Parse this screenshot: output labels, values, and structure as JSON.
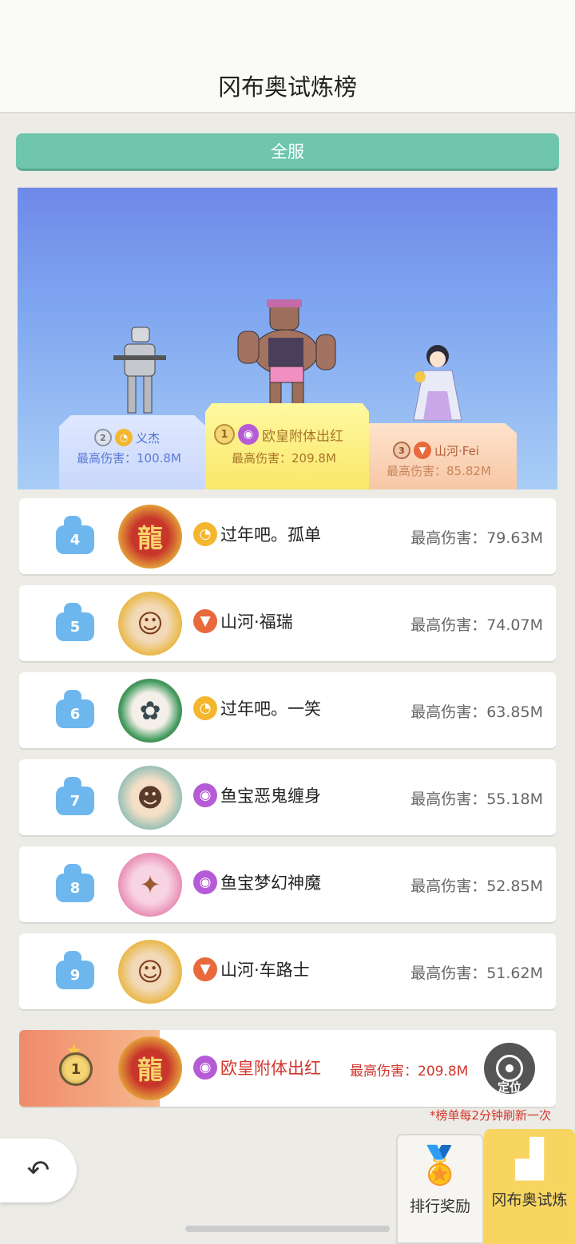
{
  "header": {
    "title": "冈布奥试炼榜"
  },
  "scope": {
    "label": "全服"
  },
  "podium": {
    "first": {
      "rank": "1",
      "server_icon": "eye-icon",
      "name": "欧皇附体出红",
      "damage": "最高伤害：209.8M"
    },
    "second": {
      "rank": "2",
      "server_icon": "gold-swirl-icon",
      "name": "义杰",
      "damage": "最高伤害：100.8M"
    },
    "third": {
      "rank": "3",
      "server_icon": "fox-icon",
      "name": "山河·Fei",
      "damage": "最高伤害：85.82M"
    }
  },
  "rows": [
    {
      "rank": "4",
      "server_icon": "gold-swirl-icon",
      "name": "过年吧。孤单",
      "damage": "最高伤害：79.63M"
    },
    {
      "rank": "5",
      "server_icon": "fox-icon",
      "name": "山河·福瑞",
      "damage": "最高伤害：74.07M"
    },
    {
      "rank": "6",
      "server_icon": "gold-swirl-icon",
      "name": "过年吧。一笑",
      "damage": "最高伤害：63.85M"
    },
    {
      "rank": "7",
      "server_icon": "eye-icon",
      "name": "鱼宝恶鬼缠身",
      "damage": "最高伤害：55.18M"
    },
    {
      "rank": "8",
      "server_icon": "eye-icon",
      "name": "鱼宝梦幻神魔",
      "damage": "最高伤害：52.85M"
    },
    {
      "rank": "9",
      "server_icon": "fox-icon",
      "name": "山河·车路士",
      "damage": "最高伤害：51.62M"
    }
  ],
  "my_rank": {
    "rank": "1",
    "server_icon": "eye-icon",
    "name": "欧皇附体出红",
    "damage": "最高伤害：209.8M",
    "locate_label": "定位"
  },
  "refresh_note": "*榜单每2分钟刷新一次",
  "tabs": {
    "rewards": "排行奖励",
    "trial": "冈布奥试炼"
  }
}
